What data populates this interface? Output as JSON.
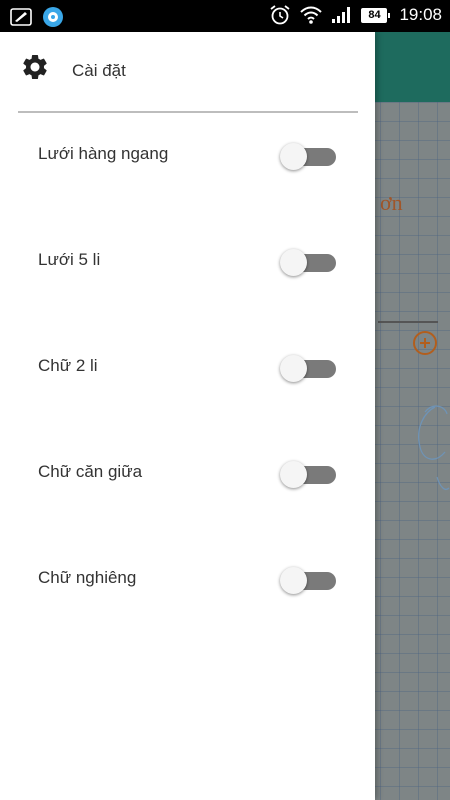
{
  "status_bar": {
    "time": "19:08",
    "battery": "84",
    "icons": [
      "edit-app-icon",
      "chat-notification-icon",
      "alarm-icon",
      "wifi-icon",
      "signal-icon",
      "battery-icon"
    ]
  },
  "drawer": {
    "title": "Cài đặt",
    "header_icon": "gear-icon",
    "settings": [
      {
        "label": "Lưới hàng ngang",
        "enabled": false
      },
      {
        "label": "Lưới 5 li",
        "enabled": false
      },
      {
        "label": "Chữ 2 li",
        "enabled": false
      },
      {
        "label": "Chữ căn giữa",
        "enabled": false
      },
      {
        "label": "Chữ nghiêng",
        "enabled": false
      }
    ]
  },
  "background": {
    "partial_text": "ơn",
    "toolbar_color": "#1e6b5e",
    "accent_color": "#b25e1d"
  }
}
